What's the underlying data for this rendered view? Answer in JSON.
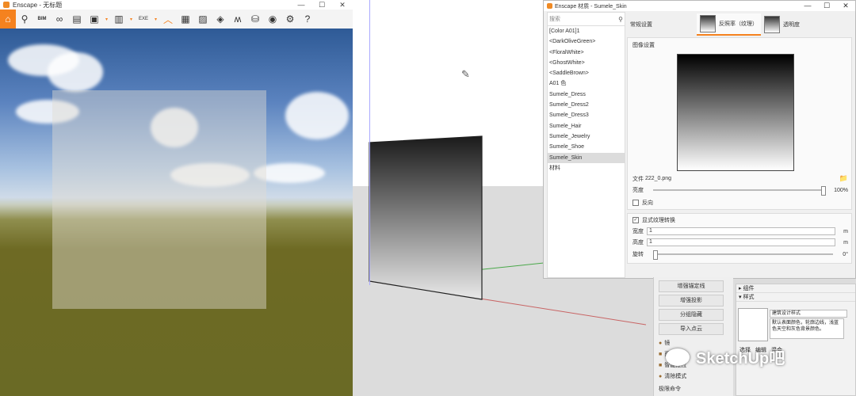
{
  "enscape": {
    "title": "Enscape - 无标题",
    "window_controls": [
      "—",
      "☐",
      "✕"
    ],
    "toolbar_icons": [
      "home-icon",
      "vr-icon",
      "bim-icon",
      "binoculars-icon",
      "clapper-icon",
      "screenshot-icon",
      "batch-render-icon",
      "export-icon",
      "arrow-icon",
      "asset-library-icon",
      "panorama-icon",
      "3d-export-icon",
      "material-editor-icon",
      "upload-icon",
      "visibility-icon",
      "settings-icon",
      "help-icon"
    ],
    "toolbar_labels": {
      "bim": "BIM",
      "export": "EXE",
      "help": "?"
    }
  },
  "material_editor": {
    "title": "Enscape 材质 - Sumele_Skin",
    "window_controls": [
      "—",
      "☐",
      "✕"
    ],
    "search_placeholder": "搜索",
    "materials": [
      "[Color A01]1",
      "<DarkOliveGreen>",
      "<FloralWhite>",
      "<GhostWhite>",
      "<SaddleBrown>",
      "A01 色",
      "Sumele_Dress",
      "Sumele_Dress2",
      "Sumele_Dress3",
      "Sumele_Hair",
      "Sumele_Jewelry",
      "Sumele_Shoe",
      "Sumele_Skin",
      "材料"
    ],
    "selected_material": "Sumele_Skin",
    "tabs": {
      "general": "常规设置",
      "reflection": "反照率（纹理）",
      "transparency": "透明度"
    },
    "image_settings_label": "图像设置",
    "file_label": "文件",
    "file_name": "222_0.png",
    "brightness_label": "亮度",
    "brightness_value": "100%",
    "brightness_fraction": 0.98,
    "invert_label": "反向",
    "explicit_transform_label": "显式纹理转换",
    "width_label": "宽度",
    "width_value": "1",
    "width_unit": "m",
    "height_label": "高度",
    "height_value": "1",
    "height_unit": "m",
    "rotation_label": "旋转",
    "rotation_value": "0°"
  },
  "tray": {
    "buttons": [
      "增强锚定线",
      "增强投影",
      "分组隐藏",
      "导入点云"
    ],
    "items": [
      {
        "icon": "●",
        "label": "镜"
      },
      {
        "icon": "■",
        "label": "面板"
      },
      {
        "icon": "■",
        "label": "智能推拉"
      },
      {
        "icon": "●",
        "label": "清除模式"
      },
      {
        "icon": "",
        "label": "极限命令"
      }
    ],
    "components_label": "组件",
    "styles_label": "样式",
    "style_name": "建筑设计样式",
    "style_desc": "默认表面颜色，轮廓边线，浅蓝色天空和灰色背景颜色。",
    "tabs": [
      "选择",
      "编辑",
      "混合"
    ]
  },
  "watermark": "SketchUp吧"
}
